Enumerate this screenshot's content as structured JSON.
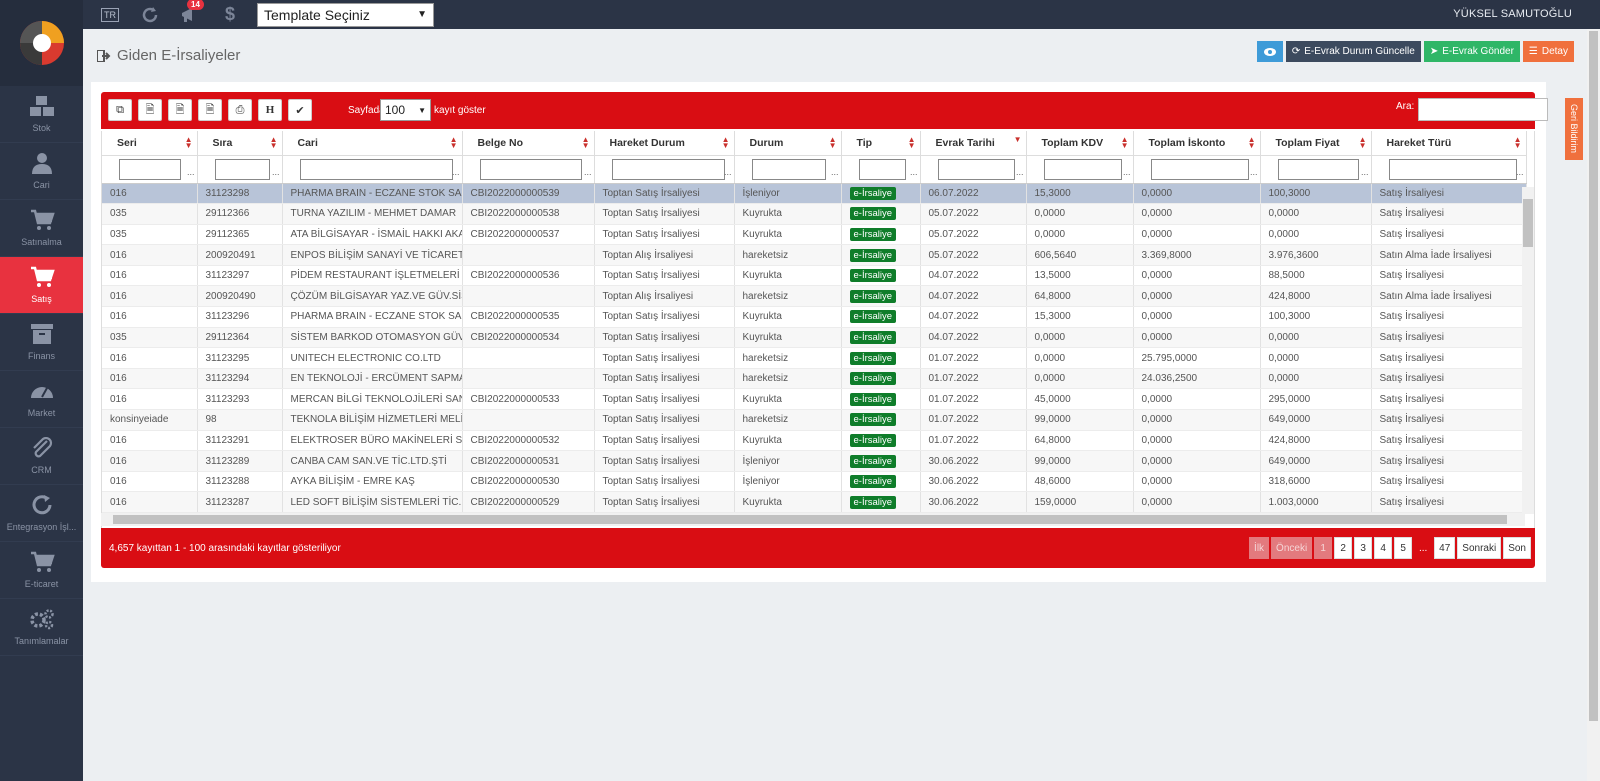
{
  "sidebar": {
    "items": [
      {
        "label": "Stok",
        "icon": "cubes-icon"
      },
      {
        "label": "Cari",
        "icon": "user-icon"
      },
      {
        "label": "Satınalma",
        "icon": "cart-icon"
      },
      {
        "label": "Satış",
        "icon": "cart-icon",
        "active": true
      },
      {
        "label": "Finans",
        "icon": "archive-icon"
      },
      {
        "label": "Market",
        "icon": "dashboard-icon"
      },
      {
        "label": "CRM",
        "icon": "paperclip-icon"
      },
      {
        "label": "Entegrasyon İşl...",
        "icon": "refresh-icon"
      },
      {
        "label": "E-ticaret",
        "icon": "cart-icon"
      },
      {
        "label": "Tanımlamalar",
        "icon": "gears-icon"
      }
    ]
  },
  "topbar": {
    "lang": "TR",
    "notif_count": "14",
    "template_select": "Template Seçiniz",
    "user": "YÜKSEL SAMUTOĞLU"
  },
  "page": {
    "title": "Giden E-İrsaliyeler",
    "buttons": {
      "status_update": "E-Evrak Durum Güncelle",
      "send": "E-Evrak Gönder",
      "detail": "Detay"
    },
    "side_tab": "Geri Bildirim"
  },
  "toolbar": {
    "sayfada": "Sayfada",
    "page_size": "100",
    "kayit_goster": "kayıt göster",
    "ara": "Ara:",
    "h_label": "H"
  },
  "table": {
    "columns": [
      "Seri",
      "Sıra",
      "Cari",
      "Belge No",
      "Hareket Durum",
      "Durum",
      "Tip",
      "Evrak Tarihi",
      "Toplam KDV",
      "Toplam İskonto",
      "Toplam Fiyat",
      "Hareket Türü"
    ],
    "rows": [
      [
        "016",
        "31123298",
        "PHARMA BRAIN - ECZANE STOK SA...",
        "CBI2022000000539",
        "Toptan Satış İrsaliyesi",
        "İşleniyor",
        "e-İrsaliye",
        "06.07.2022",
        "15,3000",
        "0,0000",
        "100,3000",
        "Satış İrsaliyesi"
      ],
      [
        "035",
        "29112366",
        "TURNA YAZILIM - MEHMET DAMAR",
        "CBI2022000000538",
        "Toptan Satış İrsaliyesi",
        "Kuyrukta",
        "e-İrsaliye",
        "05.07.2022",
        "0,0000",
        "0,0000",
        "0,0000",
        "Satış İrsaliyesi"
      ],
      [
        "035",
        "29112365",
        "ATA BİLGİSAYAR - İSMAİL HAKKI AKAN",
        "CBI2022000000537",
        "Toptan Satış İrsaliyesi",
        "Kuyrukta",
        "e-İrsaliye",
        "05.07.2022",
        "0,0000",
        "0,0000",
        "0,0000",
        "Satış İrsaliyesi"
      ],
      [
        "016",
        "200920491",
        "ENPOS BİLİŞİM SANAYİ VE TİCARET ...",
        "",
        "Toptan Alış İrsaliyesi",
        "hareketsiz",
        "e-İrsaliye",
        "05.07.2022",
        "606,5640",
        "3.369,8000",
        "3.976,3600",
        "Satın Alma İade İrsaliyesi"
      ],
      [
        "016",
        "31123297",
        "PİDEM RESTAURANT İŞLETMELERİ ...",
        "CBI2022000000536",
        "Toptan Satış İrsaliyesi",
        "Kuyrukta",
        "e-İrsaliye",
        "04.07.2022",
        "13,5000",
        "0,0000",
        "88,5000",
        "Satış İrsaliyesi"
      ],
      [
        "016",
        "200920490",
        "ÇÖZÜM BİLGİSAYAR YAZ.VE GÜV.SİS...",
        "",
        "Toptan Alış İrsaliyesi",
        "hareketsiz",
        "e-İrsaliye",
        "04.07.2022",
        "64,8000",
        "0,0000",
        "424,8000",
        "Satın Alma İade İrsaliyesi"
      ],
      [
        "016",
        "31123296",
        "PHARMA BRAIN - ECZANE STOK SA...",
        "CBI2022000000535",
        "Toptan Satış İrsaliyesi",
        "Kuyrukta",
        "e-İrsaliye",
        "04.07.2022",
        "15,3000",
        "0,0000",
        "100,3000",
        "Satış İrsaliyesi"
      ],
      [
        "035",
        "29112364",
        "SİSTEM BARKOD OTOMASYON GÜV...",
        "CBI2022000000534",
        "Toptan Satış İrsaliyesi",
        "Kuyrukta",
        "e-İrsaliye",
        "04.07.2022",
        "0,0000",
        "0,0000",
        "0,0000",
        "Satış İrsaliyesi"
      ],
      [
        "016",
        "31123295",
        "UNITECH ELECTRONIC CO.LTD",
        "",
        "Toptan Satış İrsaliyesi",
        "hareketsiz",
        "e-İrsaliye",
        "01.07.2022",
        "0,0000",
        "25.795,0000",
        "0,0000",
        "Satış İrsaliyesi"
      ],
      [
        "016",
        "31123294",
        "EN TEKNOLOJİ - ERCÜMENT SAPMAZ",
        "",
        "Toptan Satış İrsaliyesi",
        "hareketsiz",
        "e-İrsaliye",
        "01.07.2022",
        "0,0000",
        "24.036,2500",
        "0,0000",
        "Satış İrsaliyesi"
      ],
      [
        "016",
        "31123293",
        "MERCAN BİLGİ TEKNOLOJİLERİ SAN...",
        "CBI2022000000533",
        "Toptan Satış İrsaliyesi",
        "Kuyrukta",
        "e-İrsaliye",
        "01.07.2022",
        "45,0000",
        "0,0000",
        "295,0000",
        "Satış İrsaliyesi"
      ],
      [
        "konsinyeiade",
        "98",
        "TEKNOLA BİLİŞİM HİZMETLERİ MELİ...",
        "",
        "Toptan Satış İrsaliyesi",
        "hareketsiz",
        "e-İrsaliye",
        "01.07.2022",
        "99,0000",
        "0,0000",
        "649,0000",
        "Satış İrsaliyesi"
      ],
      [
        "016",
        "31123291",
        "ELEKTROSER BÜRO MAKİNELERİ SA...",
        "CBI2022000000532",
        "Toptan Satış İrsaliyesi",
        "Kuyrukta",
        "e-İrsaliye",
        "01.07.2022",
        "64,8000",
        "0,0000",
        "424,8000",
        "Satış İrsaliyesi"
      ],
      [
        "016",
        "31123289",
        "CANBA CAM SAN.VE TİC.LTD.ŞTİ",
        "CBI2022000000531",
        "Toptan Satış İrsaliyesi",
        "İşleniyor",
        "e-İrsaliye",
        "30.06.2022",
        "99,0000",
        "0,0000",
        "649,0000",
        "Satış İrsaliyesi"
      ],
      [
        "016",
        "31123288",
        "AYKA BİLİŞİM - EMRE KAŞ",
        "CBI2022000000530",
        "Toptan Satış İrsaliyesi",
        "İşleniyor",
        "e-İrsaliye",
        "30.06.2022",
        "48,6000",
        "0,0000",
        "318,6000",
        "Satış İrsaliyesi"
      ],
      [
        "016",
        "31123287",
        "LED SOFT BİLİŞİM SİSTEMLERİ TİC.L...",
        "CBI2022000000529",
        "Toptan Satış İrsaliyesi",
        "Kuyrukta",
        "e-İrsaliye",
        "30.06.2022",
        "159,0000",
        "0,0000",
        "1.003,0000",
        "Satış İrsaliyesi"
      ]
    ]
  },
  "footer": {
    "info": "4,657 kayıttan 1 - 100 arasındaki kayıtlar gösteriliyor",
    "pager": [
      "İlk",
      "Önceki",
      "1",
      "2",
      "3",
      "4",
      "5",
      "...",
      "47",
      "Sonraki",
      "Son"
    ]
  }
}
